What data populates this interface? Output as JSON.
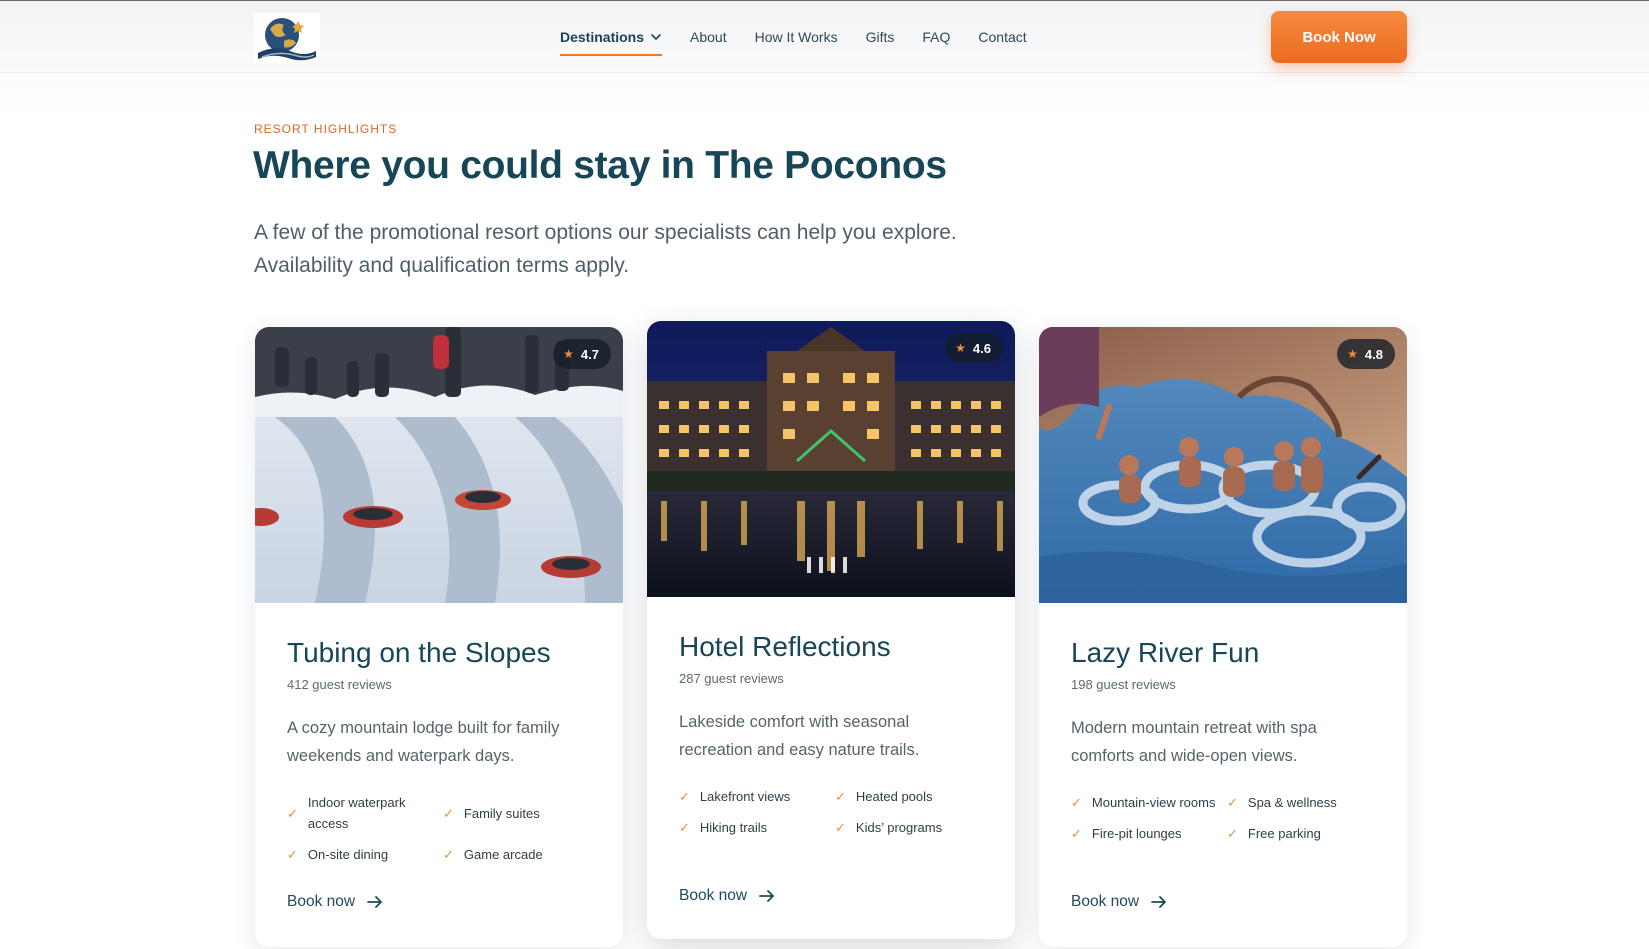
{
  "header": {
    "nav": [
      {
        "label": "Destinations",
        "active": true,
        "has_dropdown": true
      },
      {
        "label": "About"
      },
      {
        "label": "How It Works"
      },
      {
        "label": "Gifts"
      },
      {
        "label": "FAQ"
      },
      {
        "label": "Contact"
      }
    ],
    "cta_label": "Book Now"
  },
  "section": {
    "eyebrow": "RESORT HIGHLIGHTS",
    "title": "Where you could stay in The Poconos",
    "subtitle": "A few of the promotional resort options our specialists can help you explore. Availability and qualification terms apply."
  },
  "cards": [
    {
      "title": "Tubing on the Slopes",
      "rating": "4.7",
      "reviews": "412 guest reviews",
      "description": "A cozy mountain lodge built for family weekends and waterpark days.",
      "features": [
        "Indoor waterpark access",
        "Family suites",
        "On-site dining",
        "Game arcade"
      ],
      "link": "Book now"
    },
    {
      "title": "Hotel Reflections",
      "rating": "4.6",
      "reviews": "287 guest reviews",
      "description": "Lakeside comfort with seasonal recreation and easy nature trails.",
      "features": [
        "Lakefront views",
        "Heated pools",
        "Hiking trails",
        "Kids’ programs"
      ],
      "link": "Book now"
    },
    {
      "title": "Lazy River Fun",
      "rating": "4.8",
      "reviews": "198 guest reviews",
      "description": "Modern mountain retreat with spa comforts and wide-open views.",
      "features": [
        "Mountain-view rooms",
        "Spa & wellness",
        "Fire-pit lounges",
        "Free parking"
      ],
      "link": "Book now"
    }
  ],
  "colors": {
    "accent": "#ef7a2e",
    "heading": "#174656",
    "body_text": "#55646b"
  },
  "icons": {
    "chevron": "chevron-down-icon",
    "star": "star-icon",
    "check": "check-icon",
    "arrow": "arrow-right-icon"
  }
}
